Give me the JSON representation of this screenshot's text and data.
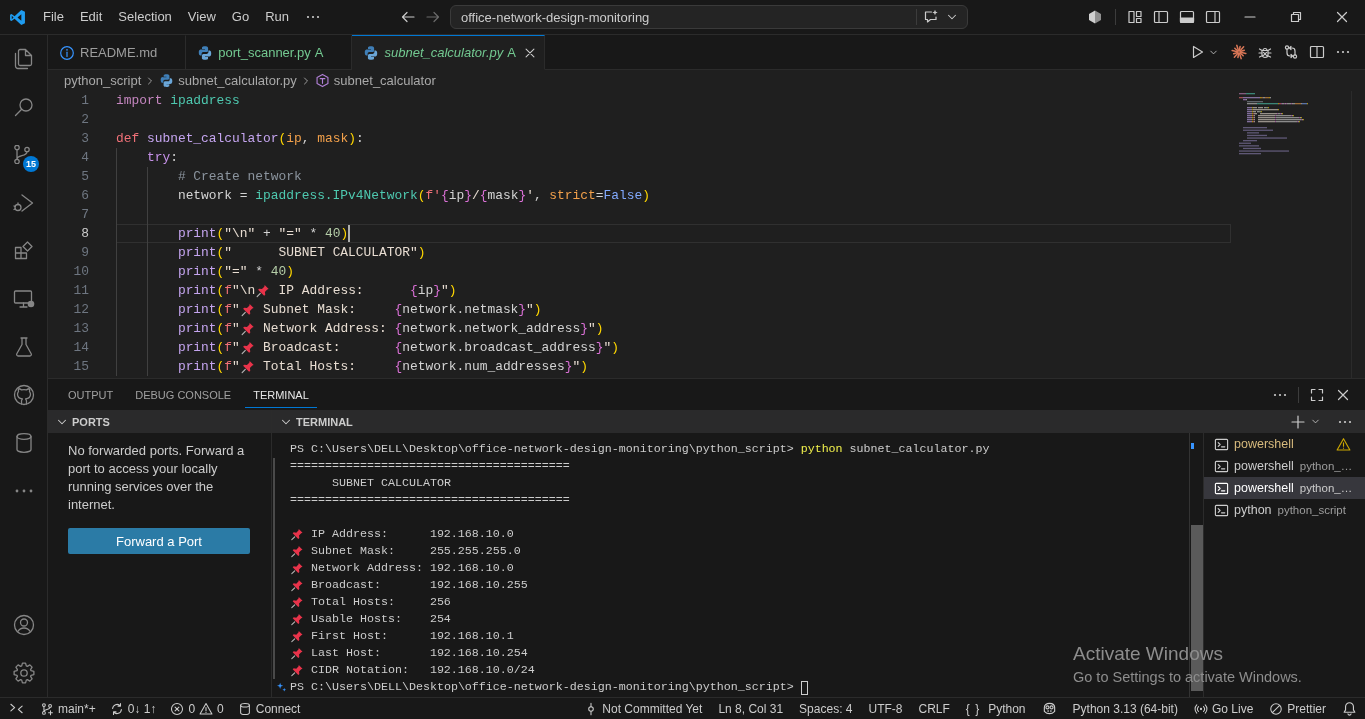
{
  "title_bar": {
    "menu": [
      "File",
      "Edit",
      "Selection",
      "View",
      "Go",
      "Run"
    ],
    "command_center": "office-network-design-monitoring"
  },
  "activity_bar": {
    "items": [
      {
        "kind": "explorer",
        "selected": false
      },
      {
        "kind": "search",
        "selected": false
      },
      {
        "kind": "source_control",
        "selected": false,
        "badge": "15"
      },
      {
        "kind": "run_debug",
        "selected": false
      },
      {
        "kind": "extensions",
        "selected": false
      },
      {
        "kind": "remote_explorer",
        "selected": false
      },
      {
        "kind": "testing",
        "selected": false
      },
      {
        "kind": "github",
        "selected": false
      },
      {
        "kind": "database",
        "selected": false
      },
      {
        "kind": "more",
        "selected": false
      }
    ],
    "bottom": [
      {
        "kind": "account"
      },
      {
        "kind": "settings"
      }
    ]
  },
  "editor_tabs": [
    {
      "label": "README.md",
      "kind": "markdown",
      "selected": false,
      "preview": false
    },
    {
      "label": "port_scanner.py",
      "kind": "python",
      "selected": false,
      "preview": false,
      "decoration": "A"
    },
    {
      "label": "subnet_calculator.py",
      "kind": "python",
      "selected": true,
      "preview": true,
      "decoration": "A"
    }
  ],
  "breadcrumbs": [
    {
      "label": "python_script",
      "kind": "folder"
    },
    {
      "label": "subnet_calculator.py",
      "kind": "python"
    },
    {
      "label": "subnet_calculator",
      "kind": "symbol"
    }
  ],
  "editor": {
    "lines": [
      {
        "number": "1",
        "active": false,
        "tokens": [
          {
            "kind": "keyword",
            "text": "import "
          },
          {
            "kind": "module",
            "text": "ipaddress"
          }
        ]
      },
      {
        "number": "2",
        "active": false
      },
      {
        "number": "3",
        "active": false,
        "tokens": [
          {
            "kind": "storage",
            "text": "def "
          },
          {
            "kind": "function",
            "text": "subnet_calculator"
          },
          {
            "kind": "paren",
            "text": "("
          },
          {
            "kind": "param",
            "text": "ip"
          },
          {
            "kind": "plain",
            "text": ", "
          },
          {
            "kind": "param",
            "text": "mask"
          },
          {
            "kind": "paren",
            "text": ")"
          },
          {
            "kind": "plain",
            "text": ":"
          }
        ]
      },
      {
        "number": "4",
        "active": false,
        "tokens": [
          {
            "kind": "control",
            "text": "    try"
          },
          {
            "kind": "plain",
            "text": ":"
          }
        ]
      },
      {
        "number": "5",
        "active": false,
        "tokens": [
          {
            "kind": "comment",
            "text": "        # Create network"
          }
        ]
      },
      {
        "number": "6",
        "active": false,
        "tokens": [
          {
            "kind": "plain",
            "text": "        network = "
          },
          {
            "kind": "module",
            "text": "ipaddress.IPv4Network"
          },
          {
            "kind": "paren",
            "text": "("
          },
          {
            "kind": "fprefix",
            "text": "f'"
          },
          {
            "kind": "brace",
            "text": "{"
          },
          {
            "kind": "plain",
            "text": "ip"
          },
          {
            "kind": "brace",
            "text": "}"
          },
          {
            "kind": "string",
            "text": "/"
          },
          {
            "kind": "brace",
            "text": "{"
          },
          {
            "kind": "plain",
            "text": "mask"
          },
          {
            "kind": "brace",
            "text": "}"
          },
          {
            "kind": "string",
            "text": "'"
          },
          {
            "kind": "plain",
            "text": ", "
          },
          {
            "kind": "param",
            "text": "strict"
          },
          {
            "kind": "plain",
            "text": "="
          },
          {
            "kind": "constant",
            "text": "False"
          },
          {
            "kind": "paren",
            "text": ")"
          }
        ]
      },
      {
        "number": "7",
        "active": false
      },
      {
        "number": "8",
        "active": true,
        "tokens": [
          {
            "kind": "function",
            "text": "        print"
          },
          {
            "kind": "paren",
            "text": "("
          },
          {
            "kind": "string",
            "text": "\"\\n\""
          },
          {
            "kind": "plain",
            "text": " + "
          },
          {
            "kind": "string",
            "text": "\"=\""
          },
          {
            "kind": "plain",
            "text": " * "
          },
          {
            "kind": "number",
            "text": "40"
          },
          {
            "kind": "paren",
            "text": ")"
          }
        ]
      },
      {
        "number": "9",
        "active": false,
        "tokens": [
          {
            "kind": "function",
            "text": "        print"
          },
          {
            "kind": "paren",
            "text": "("
          },
          {
            "kind": "string",
            "text": "\"      SUBNET CALCULATOR\""
          },
          {
            "kind": "paren",
            "text": ")"
          }
        ]
      },
      {
        "number": "10",
        "active": false,
        "tokens": [
          {
            "kind": "function",
            "text": "        print"
          },
          {
            "kind": "paren",
            "text": "("
          },
          {
            "kind": "string",
            "text": "\"=\""
          },
          {
            "kind": "plain",
            "text": " * "
          },
          {
            "kind": "number",
            "text": "40"
          },
          {
            "kind": "paren",
            "text": ")"
          }
        ]
      },
      {
        "number": "11",
        "active": false,
        "tokens": [
          {
            "kind": "function",
            "text": "        print"
          },
          {
            "kind": "paren",
            "text": "("
          },
          {
            "kind": "fprefix",
            "text": "f"
          },
          {
            "kind": "string",
            "text": "\"\\n"
          },
          {
            "kind": "pin"
          },
          {
            "kind": "string",
            "text": " IP Address:      "
          },
          {
            "kind": "brace",
            "text": "{"
          },
          {
            "kind": "plain",
            "text": "ip"
          },
          {
            "kind": "brace",
            "text": "}"
          },
          {
            "kind": "string",
            "text": "\""
          },
          {
            "kind": "paren",
            "text": ")"
          }
        ]
      },
      {
        "number": "12",
        "active": false,
        "tokens": [
          {
            "kind": "function",
            "text": "        print"
          },
          {
            "kind": "paren",
            "text": "("
          },
          {
            "kind": "fprefix",
            "text": "f"
          },
          {
            "kind": "string",
            "text": "\""
          },
          {
            "kind": "pin"
          },
          {
            "kind": "string",
            "text": " Subnet Mask:     "
          },
          {
            "kind": "brace",
            "text": "{"
          },
          {
            "kind": "plain",
            "text": "network.netmask"
          },
          {
            "kind": "brace",
            "text": "}"
          },
          {
            "kind": "string",
            "text": "\""
          },
          {
            "kind": "paren",
            "text": ")"
          }
        ]
      },
      {
        "number": "13",
        "active": false,
        "tokens": [
          {
            "kind": "function",
            "text": "        print"
          },
          {
            "kind": "paren",
            "text": "("
          },
          {
            "kind": "fprefix",
            "text": "f"
          },
          {
            "kind": "string",
            "text": "\""
          },
          {
            "kind": "pin"
          },
          {
            "kind": "string",
            "text": " Network Address: "
          },
          {
            "kind": "brace",
            "text": "{"
          },
          {
            "kind": "plain",
            "text": "network.network_address"
          },
          {
            "kind": "brace",
            "text": "}"
          },
          {
            "kind": "string",
            "text": "\""
          },
          {
            "kind": "paren",
            "text": ")"
          }
        ]
      },
      {
        "number": "14",
        "active": false,
        "tokens": [
          {
            "kind": "function",
            "text": "        print"
          },
          {
            "kind": "paren",
            "text": "("
          },
          {
            "kind": "fprefix",
            "text": "f"
          },
          {
            "kind": "string",
            "text": "\""
          },
          {
            "kind": "pin"
          },
          {
            "kind": "string",
            "text": " Broadcast:       "
          },
          {
            "kind": "brace",
            "text": "{"
          },
          {
            "kind": "plain",
            "text": "network.broadcast_address"
          },
          {
            "kind": "brace",
            "text": "}"
          },
          {
            "kind": "string",
            "text": "\""
          },
          {
            "kind": "paren",
            "text": ")"
          }
        ]
      },
      {
        "number": "15",
        "active": false,
        "tokens": [
          {
            "kind": "function",
            "text": "        print"
          },
          {
            "kind": "paren",
            "text": "("
          },
          {
            "kind": "fprefix",
            "text": "f"
          },
          {
            "kind": "string",
            "text": "\""
          },
          {
            "kind": "pin"
          },
          {
            "kind": "string",
            "text": " Total Hosts:     "
          },
          {
            "kind": "brace",
            "text": "{"
          },
          {
            "kind": "plain",
            "text": "network.num_addresses"
          },
          {
            "kind": "brace",
            "text": "}"
          },
          {
            "kind": "string",
            "text": "\""
          },
          {
            "kind": "paren",
            "text": ")"
          }
        ]
      }
    ]
  },
  "panel": {
    "tabs": [
      {
        "label": "OUTPUT",
        "selected": false
      },
      {
        "label": "DEBUG CONSOLE",
        "selected": false
      },
      {
        "label": "TERMINAL",
        "selected": true
      }
    ],
    "ports": {
      "title": "PORTS",
      "expanded": true,
      "message": "No forwarded ports. Forward a port to access your locally running services over the internet.",
      "button": "Forward a Port"
    },
    "terminal": {
      "title": "TERMINAL",
      "expanded": true,
      "lines": [
        {
          "kind": "prompt",
          "prompt": "PS C:\\Users\\DELL\\Desktop\\office-network-design-monitoring\\python_script>",
          "command": "python",
          "args": "subnet_calculator.py",
          "cursor": false
        },
        {
          "kind": "text",
          "text": "========================================"
        },
        {
          "kind": "text",
          "text": "      SUBNET CALCULATOR"
        },
        {
          "kind": "text",
          "text": "========================================"
        },
        {
          "kind": "blank"
        },
        {
          "kind": "pin",
          "text": "IP Address:      192.168.10.0"
        },
        {
          "kind": "pin",
          "text": "Subnet Mask:     255.255.255.0"
        },
        {
          "kind": "pin",
          "text": "Network Address: 192.168.10.0"
        },
        {
          "kind": "pin",
          "text": "Broadcast:       192.168.10.255"
        },
        {
          "kind": "pin",
          "text": "Total Hosts:     256"
        },
        {
          "kind": "pin",
          "text": "Usable Hosts:    254"
        },
        {
          "kind": "pin",
          "text": "First Host:      192.168.10.1"
        },
        {
          "kind": "pin",
          "text": "Last Host:       192.168.10.254"
        },
        {
          "kind": "pin",
          "text": "CIDR Notation:   192.168.10.0/24"
        },
        {
          "kind": "prompt",
          "prompt": "PS C:\\Users\\DELL\\Desktop\\office-network-design-monitoring\\python_script>",
          "cursor": true,
          "hint": true
        }
      ],
      "sessions": [
        {
          "name": "powershell",
          "selected": false,
          "warning": true
        },
        {
          "name": "powershell",
          "description": "python_…",
          "selected": false,
          "warning": false
        },
        {
          "name": "powershell",
          "description": "python_…",
          "selected": true,
          "warning": false
        },
        {
          "name": "python",
          "description": "python_script",
          "selected": false,
          "warning": false
        }
      ]
    }
  },
  "status_bar": {
    "left": [
      {
        "kind": "remote"
      },
      {
        "kind": "branch",
        "text": "main*+"
      },
      {
        "kind": "sync",
        "text": "0↓ 1↑"
      },
      {
        "kind": "problems",
        "errors": "0",
        "warnings": "0"
      },
      {
        "kind": "database",
        "text": "Connect"
      }
    ],
    "right": [
      {
        "kind": "commit",
        "text": "Not Committed Yet"
      },
      {
        "kind": "text",
        "text": "Ln 8, Col 31"
      },
      {
        "kind": "text",
        "text": "Spaces: 4"
      },
      {
        "kind": "text",
        "text": "UTF-8"
      },
      {
        "kind": "text",
        "text": "CRLF"
      },
      {
        "kind": "language",
        "symbol": "{ }",
        "text": "Python"
      },
      {
        "kind": "copilot"
      },
      {
        "kind": "text",
        "text": "Python 3.13 (64-bit)"
      },
      {
        "kind": "live",
        "text": "Go Live"
      },
      {
        "kind": "prettier",
        "text": "Prettier"
      },
      {
        "kind": "bell"
      }
    ]
  },
  "activation_notice": {
    "title": "Activate Windows",
    "text": "Go to Settings to activate Windows."
  }
}
